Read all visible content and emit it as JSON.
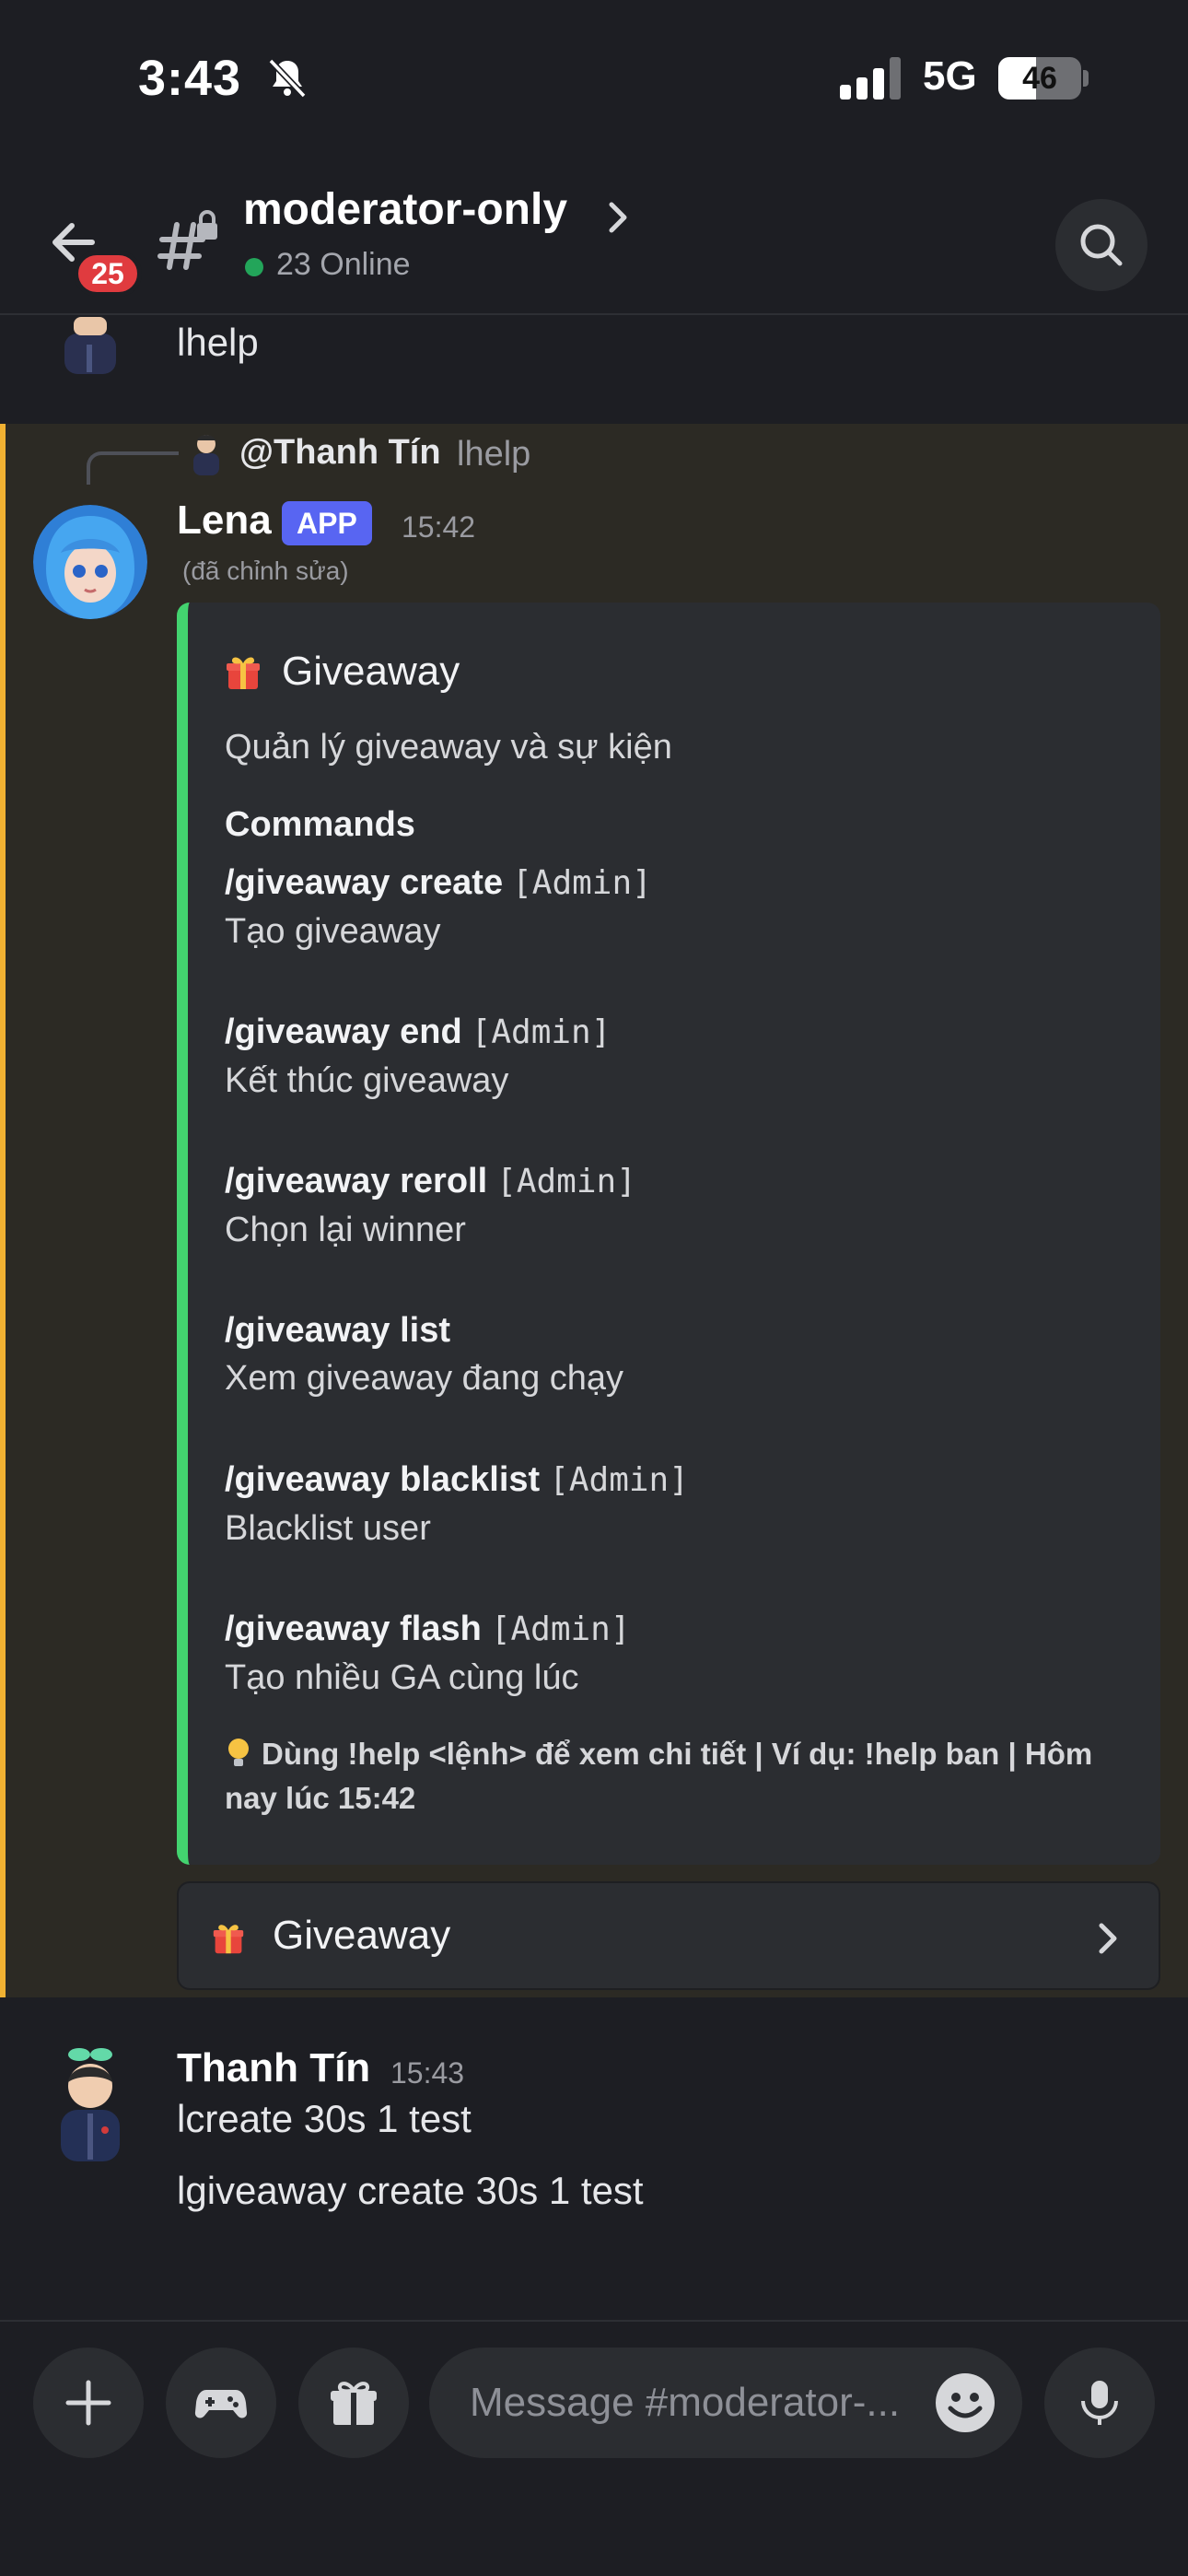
{
  "status_bar": {
    "time": "3:43",
    "network": "5G",
    "battery_level": "46",
    "battery_fraction": 0.46
  },
  "header": {
    "channel_name": "moderator-only",
    "online": "23 Online",
    "back_badge": "25"
  },
  "messages": {
    "previous_text": "lhelp",
    "reply": {
      "user": "@Thanh Tín",
      "text": "lhelp"
    },
    "bot": {
      "name": "Lena",
      "tag": "APP",
      "time": "15:42",
      "edited": "(đã chỉnh sửa)",
      "embed": {
        "title": "Giveaway",
        "description": "Quản lý giveaway và sự kiện",
        "field_name": "Commands",
        "commands": [
          {
            "name": "/giveaway create",
            "role": "[Admin]",
            "desc": "Tạo giveaway"
          },
          {
            "name": "/giveaway end",
            "role": "[Admin]",
            "desc": "Kết thúc giveaway"
          },
          {
            "name": "/giveaway reroll",
            "role": "[Admin]",
            "desc": "Chọn lại winner"
          },
          {
            "name": "/giveaway list",
            "role": "",
            "desc": "Xem giveaway đang chạy"
          },
          {
            "name": "/giveaway blacklist",
            "role": "[Admin]",
            "desc": "Blacklist user"
          },
          {
            "name": "/giveaway flash",
            "role": "[Admin]",
            "desc": "Tạo nhiều GA cùng lúc"
          }
        ],
        "footer": "Dùng !help <lệnh> để xem chi tiết | Ví dụ: !help ban | Hôm nay lúc 15:42",
        "accent_color": "#43d36f"
      },
      "select_menu_label": "Giveaway"
    },
    "user_message": {
      "name": "Thanh Tín",
      "time": "15:43",
      "lines": [
        "lcreate 30s 1 test",
        "lgiveaway create 30s 1 test"
      ]
    }
  },
  "composer": {
    "placeholder": "Message #moderator-..."
  },
  "colors": {
    "highlight_bar": "#f0b132",
    "badge": "#e03b3f",
    "app_tag": "#5865f2",
    "online": "#23a55a"
  },
  "icons": [
    "bell-slash-icon",
    "signal-icon",
    "back-arrow-icon",
    "hash-lock-icon",
    "chevron-right-icon",
    "search-icon",
    "gift-icon",
    "plus-icon",
    "gamepad-icon",
    "emoji-icon",
    "microphone-icon"
  ]
}
